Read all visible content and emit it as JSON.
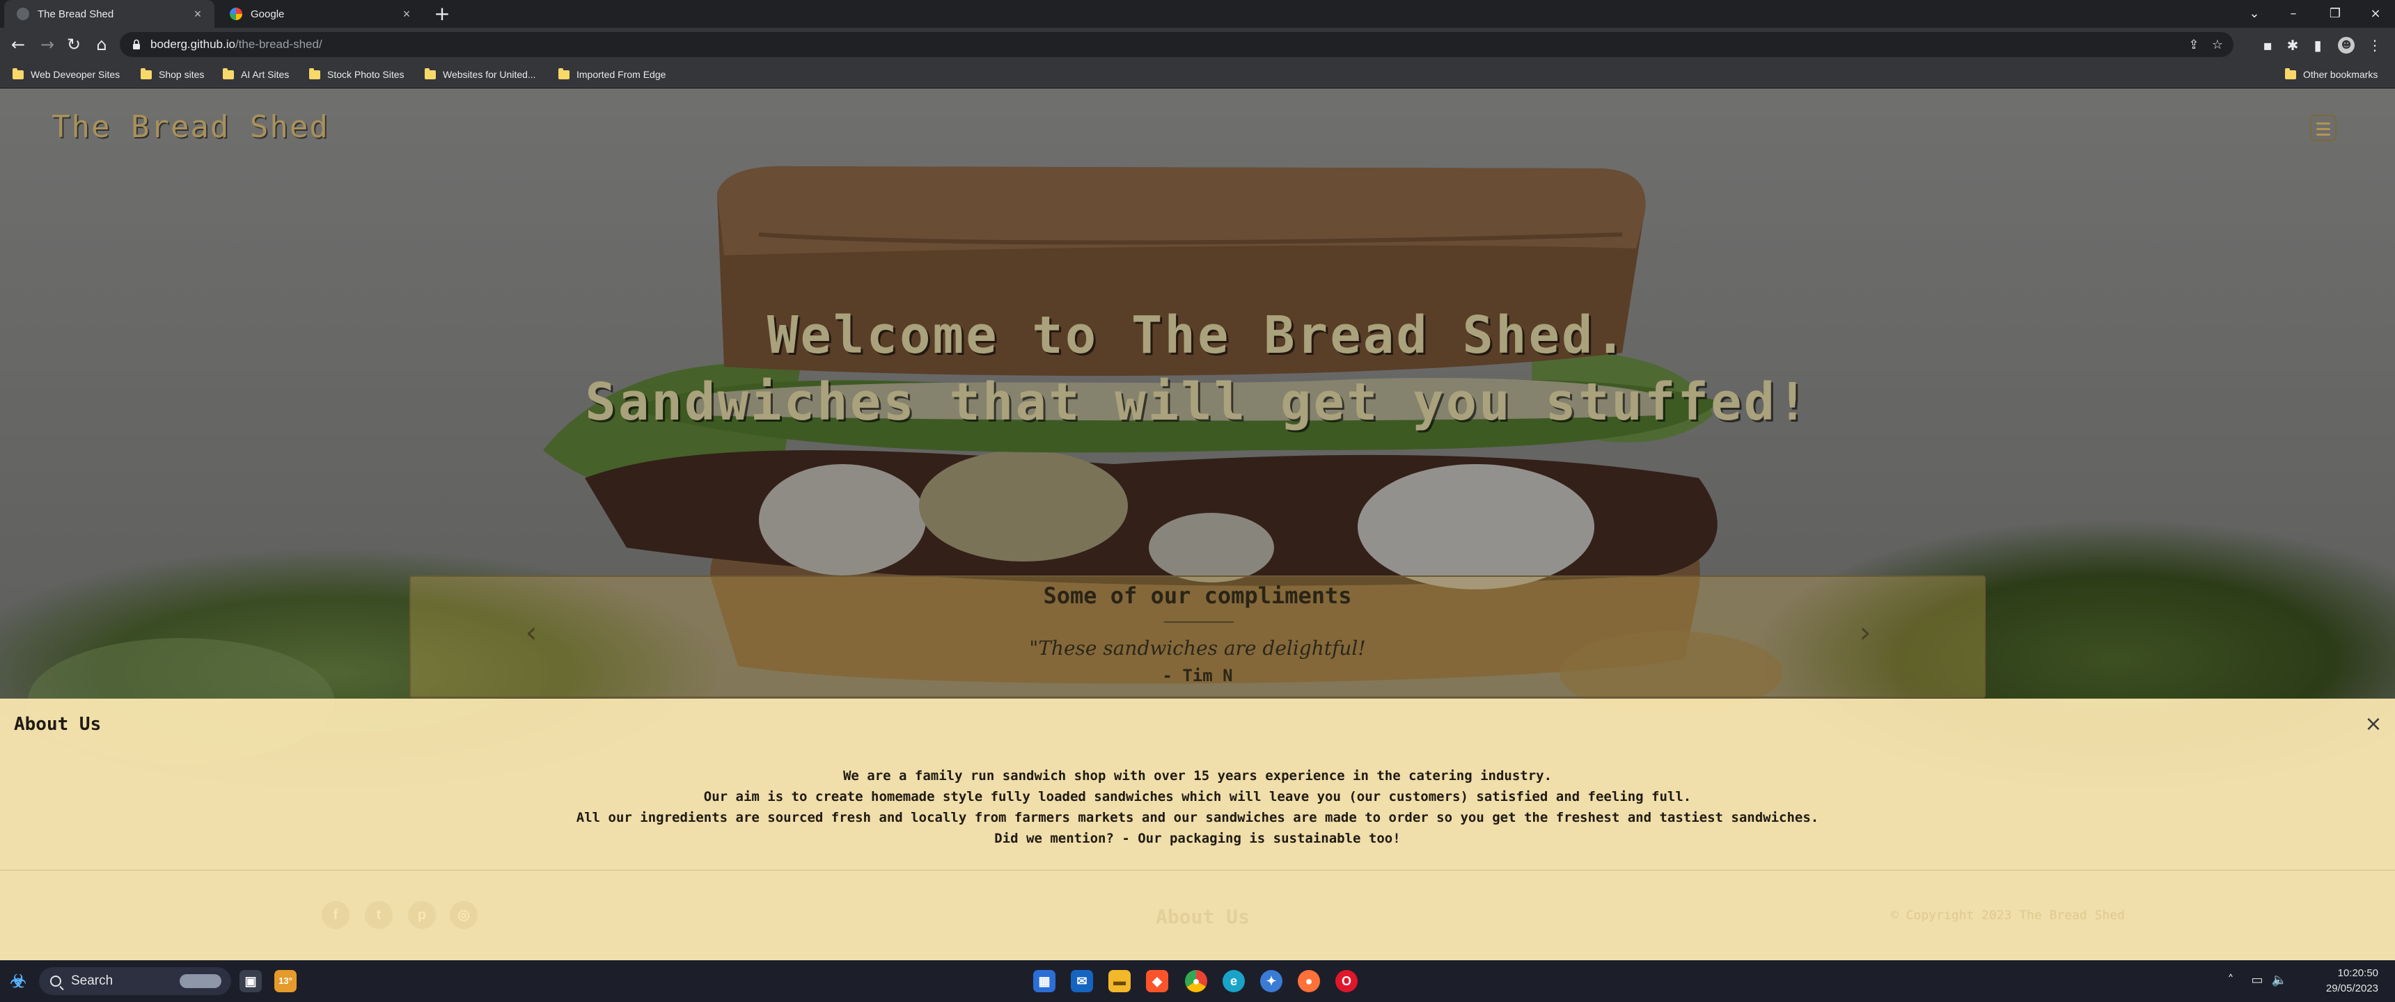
{
  "browser": {
    "tabs": [
      {
        "title": "The Bread Shed",
        "active": true
      },
      {
        "title": "Google",
        "active": false
      }
    ],
    "new_tab": "+",
    "url": {
      "host": "boderg.github.io",
      "path": "/the-bread-shed/"
    },
    "bookmarks": [
      "Web Deveoper Sites",
      "Shop sites",
      "AI Art Sites",
      "Stock Photo Sites",
      "Websites for United...",
      "Imported From Edge"
    ],
    "other_bookmarks": "Other bookmarks"
  },
  "site": {
    "logo": "The Bread Shed",
    "hero": {
      "line1": "Welcome to The Bread Shed.",
      "line2": "Sandwiches that will get you stuffed!"
    },
    "compliments": {
      "title": "Some of our compliments",
      "quote": "\"These sandwiches are delightful!",
      "author": "- Tim N"
    },
    "about": {
      "title": "About Us",
      "paragraphs": [
        "We are a family run sandwich shop with over 15 years experience in the catering industry.",
        "Our aim is to create homemade style fully loaded sandwiches which will leave you (our customers) satisfied and feeling full.",
        "All our ingredients are sourced fresh and locally from farmers markets and our sandwiches are made to order so you get the freshest and tastiest sandwiches.",
        "Did we mention? - Our packaging is sustainable too!"
      ]
    },
    "footer": {
      "link": "About Us",
      "copyright": "© Copyright 2023 The Bread Shed",
      "social": [
        "facebook-icon",
        "twitter-icon",
        "pinterest-icon",
        "instagram-icon"
      ]
    },
    "colors": {
      "accent": "#a8915b",
      "about_bg": "#fce8b2",
      "carousel_border": "#6a5a32"
    }
  },
  "taskbar": {
    "search_label": "Search",
    "weather_temp": "13°",
    "time": "10:20:50",
    "date": "29/05/2023"
  }
}
